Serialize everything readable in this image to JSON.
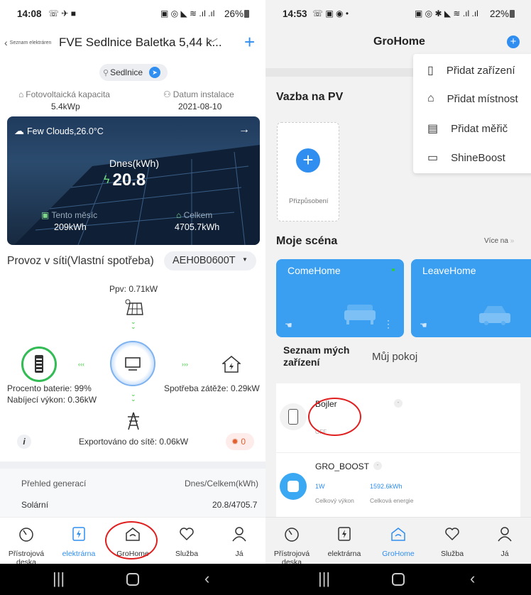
{
  "left": {
    "status_time": "14:08",
    "status_battery": "26%",
    "back_label": "Seznam elektráren",
    "plant_title": "FVE Sedlnice Baletka 5,44 k...",
    "location": "Sedlnice",
    "pv_capacity_label": "Fotovoltaická kapacita",
    "pv_capacity_value": "5.4kWp",
    "install_date_label": "Datum instalace",
    "install_date_value": "2021-08-10",
    "weather": "Few Clouds,26.0°C",
    "today_label": "Dnes(kWh)",
    "today_value": "20.8",
    "month_label": "Tento měsíc",
    "month_value": "209kWh",
    "total_label": "Celkem",
    "total_value": "4705.7kWh",
    "grid_mode": "Provoz v síti(Vlastní spotřeba)",
    "device_select": "AEH0B0600T",
    "ppv": "Ppv: 0.71kW",
    "battery_pct": "Procento baterie: 99%",
    "charge_power": "Nabíjecí výkon: 0.36kW",
    "load": "Spotřeba zátěže: 0.29kW",
    "export": "Exportováno do sítě: 0.06kW",
    "alarm_count": "0",
    "overview_label": "Přehled generací",
    "overview_unit": "Dnes/Celkem(kWh)",
    "solar_label": "Solární",
    "solar_value": "20.8/4705.7",
    "tabs": [
      "Přístrojová deska",
      "elektrárna",
      "GroHome",
      "Služba",
      "Já"
    ]
  },
  "right": {
    "status_time": "14:53",
    "status_battery": "22%",
    "title": "GroHome",
    "menu": [
      "Přidat zařízení",
      "Přidat místnost",
      "Přidat měřič",
      "ShineBoost"
    ],
    "pv_binding": "Vazba na PV",
    "customize": "Přizpůsobení",
    "scenes_title": "Moje scéna",
    "more": "Více na",
    "scene1": "ComeHome",
    "scene2": "LeaveHome",
    "devices_tab": "Seznam mých zařízení",
    "room_tab": "Můj pokoj",
    "device1_name": "Bojler",
    "device1_state": "OFF",
    "device2_name": "GRO_BOOST",
    "device2_power": "1W",
    "device2_power_label": "Celkový výkon",
    "device2_energy": "1592.6kWh",
    "device2_energy_label": "Celková energie",
    "tabs": [
      "Přístrojová deska",
      "elektrárna",
      "GroHome",
      "Služba",
      "Já"
    ]
  },
  "colors": {
    "accent": "#2f8ef0",
    "highlight": "#e02020",
    "green": "#33bb55"
  }
}
